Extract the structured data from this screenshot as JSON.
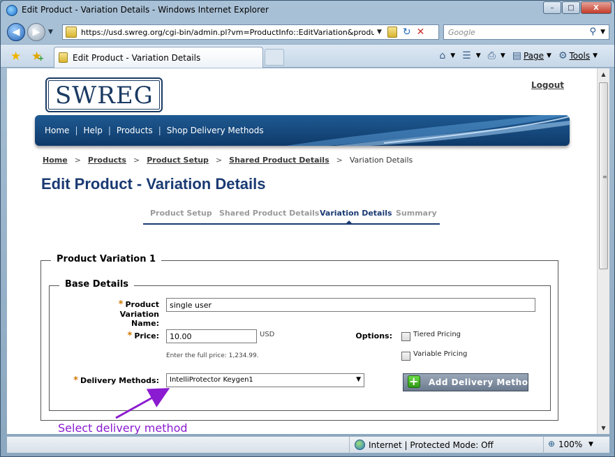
{
  "window": {
    "title": "Edit Product - Variation Details - Windows Internet Explorer",
    "min_label": "–",
    "max_label": "□",
    "close_label": "X"
  },
  "address_bar": {
    "url": "https://usd.swreg.org/cgi-bin/admin.pl?vm=ProductInfo::EditVariation&produ",
    "search_placeholder": "Google"
  },
  "tabs": [
    {
      "label": "Edit Product - Variation Details"
    }
  ],
  "command_bar": {
    "page_label": "Page",
    "tools_label": "Tools"
  },
  "page": {
    "logo_text": "SWREG",
    "logout_label": "Logout",
    "nav": [
      "Home",
      "Help",
      "Products",
      "Shop Delivery Methods"
    ],
    "breadcrumb": {
      "links": [
        "Home",
        "Products",
        "Product Setup",
        "Shared Product Details"
      ],
      "current": "Variation Details"
    },
    "title": "Edit Product - Variation Details",
    "wizard_steps": [
      {
        "label": "Product Setup",
        "active": false
      },
      {
        "label": "Shared Product Details",
        "active": false
      },
      {
        "label": "Variation Details",
        "active": true
      },
      {
        "label": "Summary",
        "active": false
      }
    ],
    "variation": {
      "legend": "Product Variation 1",
      "base_legend": "Base Details",
      "name_label_1": "Product Variation",
      "name_label_2": "Name:",
      "name_value": "single user",
      "price_label": "Price:",
      "price_value": "10.00",
      "currency": "USD",
      "price_hint": "Enter the full price: 1,234.99.",
      "options_label": "Options:",
      "option_tiered": "Tiered Pricing",
      "option_variable": "Variable Pricing",
      "delivery_label": "Delivery Methods:",
      "delivery_selected": "IntelliProtector Keygen1",
      "add_button": "Add Delivery Method"
    },
    "annotation": "Select delivery method"
  },
  "status_bar": {
    "zone": "Internet | Protected Mode: Off",
    "zoom": "100%"
  },
  "colors": {
    "brand_navy": "#1a3a72",
    "banner": "#1e5a92",
    "annotation": "#8a1bd0",
    "required": "#d07a00"
  }
}
